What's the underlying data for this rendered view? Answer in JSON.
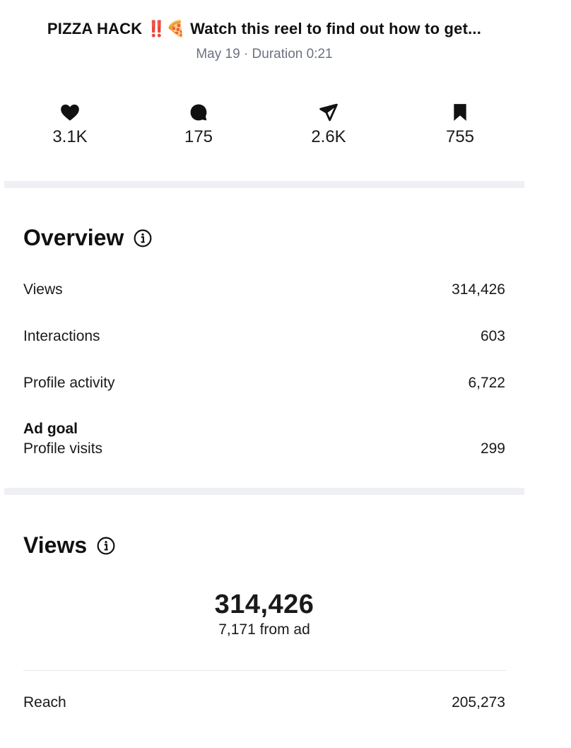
{
  "post": {
    "title_prefix": "PIZZA HACK",
    "title_bang": "‼️",
    "title_emoji": "🍕",
    "title_rest": "Watch this reel to find out how to get...",
    "meta": "May 19 · Duration 0:21"
  },
  "stats": {
    "likes": "3.1K",
    "comments": "175",
    "shares": "2.6K",
    "saves": "755"
  },
  "overview": {
    "title": "Overview",
    "rows": [
      {
        "label": "Views",
        "value": "314,426"
      },
      {
        "label": "Interactions",
        "value": "603"
      },
      {
        "label": "Profile activity",
        "value": "6,722"
      }
    ],
    "ad_goal_label": "Ad goal",
    "ad_goal_row": {
      "label": "Profile visits",
      "value": "299"
    }
  },
  "views": {
    "title": "Views",
    "total": "314,426",
    "from_ad": "7,171 from ad",
    "reach_label": "Reach",
    "reach_value": "205,273"
  },
  "icons": {
    "like": "heart-icon",
    "comment": "comment-icon",
    "share": "send-icon",
    "save": "bookmark-icon",
    "info": "info-icon"
  }
}
